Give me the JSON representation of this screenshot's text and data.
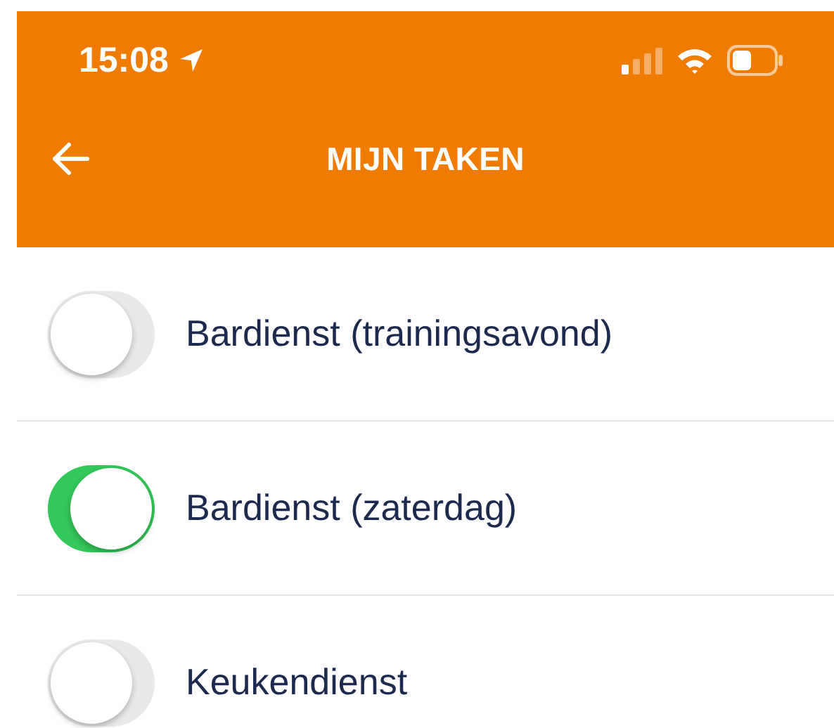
{
  "status_bar": {
    "time": "15:08"
  },
  "header": {
    "title": "MIJN TAKEN"
  },
  "tasks": [
    {
      "label": "Bardienst (trainingsavond)",
      "on": false
    },
    {
      "label": "Bardienst (zaterdag)",
      "on": true
    },
    {
      "label": "Keukendienst",
      "on": false
    }
  ]
}
